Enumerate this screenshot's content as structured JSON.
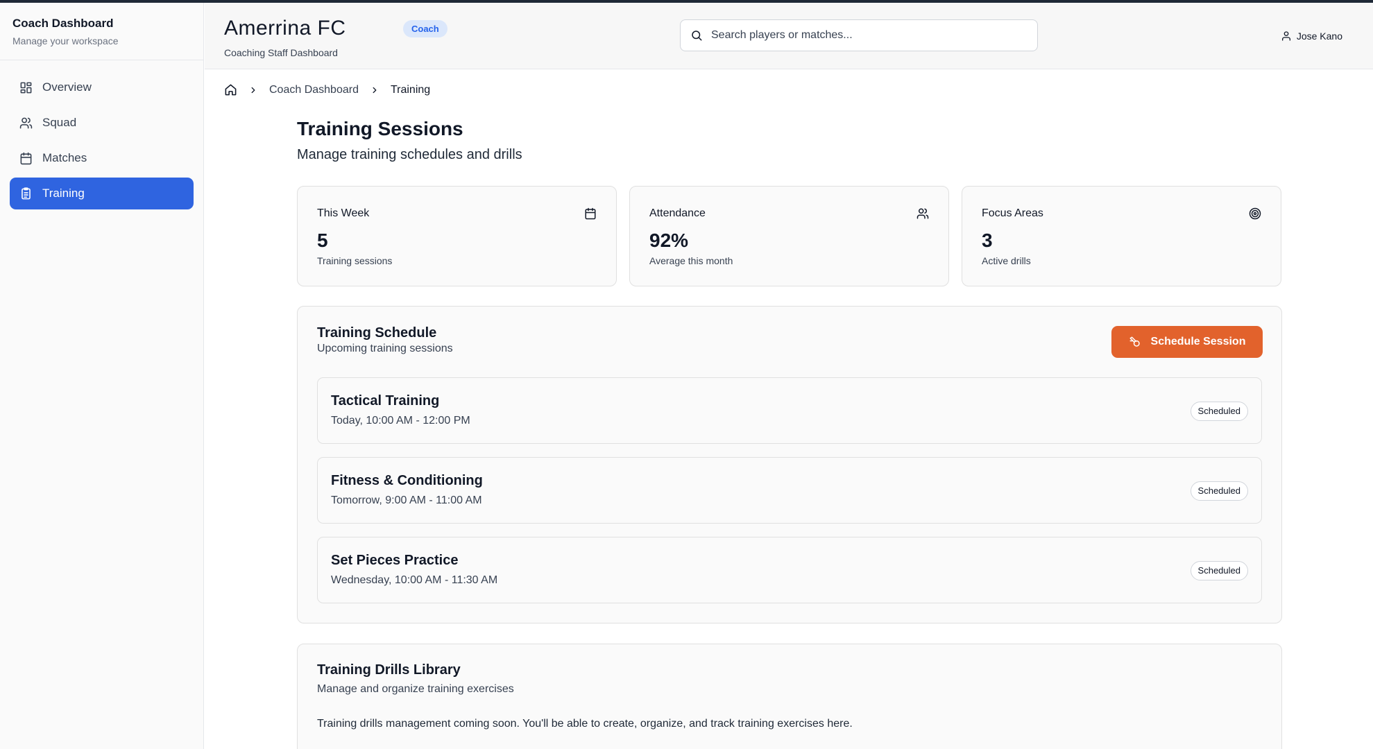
{
  "sidebar": {
    "title": "Coach Dashboard",
    "subtitle": "Manage your workspace",
    "items": [
      {
        "label": "Overview",
        "icon": "grid-icon"
      },
      {
        "label": "Squad",
        "icon": "users-icon"
      },
      {
        "label": "Matches",
        "icon": "calendar-icon"
      },
      {
        "label": "Training",
        "icon": "clipboard-icon",
        "active": true
      }
    ]
  },
  "header": {
    "team_name": "Amerrina FC",
    "team_subtitle": "Coaching Staff Dashboard",
    "role_badge": "Coach",
    "search_placeholder": "Search players or matches...",
    "user_name": "Jose Kano"
  },
  "breadcrumb": {
    "items": [
      "Coach Dashboard",
      "Training"
    ]
  },
  "page": {
    "title": "Training Sessions",
    "subtitle": "Manage training schedules and drills"
  },
  "stats": [
    {
      "label": "This Week",
      "value": "5",
      "caption": "Training sessions",
      "icon": "calendar-icon"
    },
    {
      "label": "Attendance",
      "value": "92%",
      "caption": "Average this month",
      "icon": "users-icon"
    },
    {
      "label": "Focus Areas",
      "value": "3",
      "caption": "Active drills",
      "icon": "target-icon"
    }
  ],
  "schedule": {
    "title": "Training Schedule",
    "subtitle": "Upcoming training sessions",
    "button_label": "Schedule Session",
    "sessions": [
      {
        "title": "Tactical Training",
        "time": "Today, 10:00 AM - 12:00 PM",
        "status": "Scheduled"
      },
      {
        "title": "Fitness & Conditioning",
        "time": "Tomorrow, 9:00 AM - 11:00 AM",
        "status": "Scheduled"
      },
      {
        "title": "Set Pieces Practice",
        "time": "Wednesday, 10:00 AM - 11:30 AM",
        "status": "Scheduled"
      }
    ]
  },
  "library": {
    "title": "Training Drills Library",
    "subtitle": "Manage and organize training exercises",
    "text": "Training drills management coming soon. You'll be able to create, organize, and track training exercises here."
  },
  "colors": {
    "accent": "#2f64e0",
    "cta": "#e2622c",
    "badge_bg": "#dbe7fb"
  }
}
